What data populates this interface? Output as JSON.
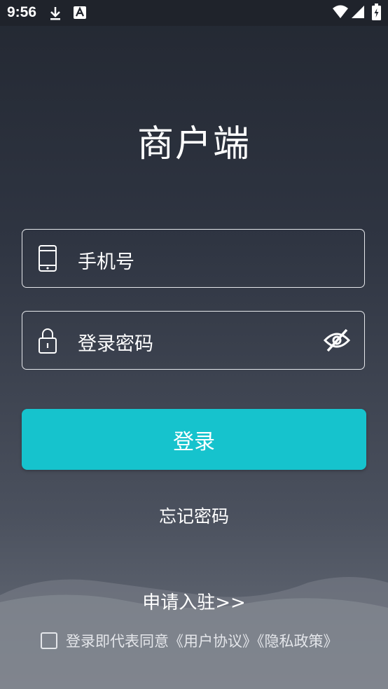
{
  "status": {
    "time": "9:56",
    "icons": [
      "download-icon",
      "a-notification-icon",
      "wifi-icon",
      "signal-icon",
      "battery-icon"
    ]
  },
  "app": {
    "title": "商户端"
  },
  "form": {
    "phone_placeholder": "手机号",
    "password_placeholder": "登录密码",
    "login_label": "登录",
    "forgot_label": "忘记密码"
  },
  "footer": {
    "apply_label": "申请入驻>>",
    "agreement_text": "登录即代表同意《用户协议》《隐私政策》"
  },
  "colors": {
    "accent": "#16c3cd"
  }
}
